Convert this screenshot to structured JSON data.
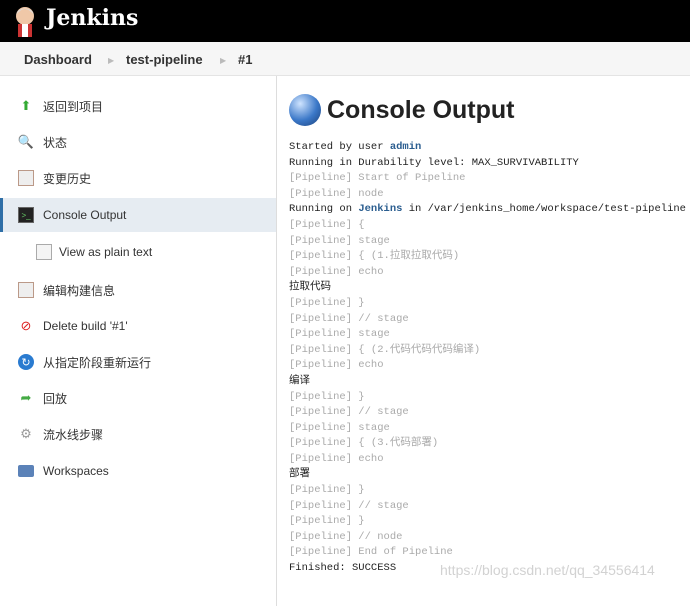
{
  "header": {
    "brand": "Jenkins"
  },
  "breadcrumb": [
    "Dashboard",
    "test-pipeline",
    "#1"
  ],
  "sidebar": {
    "items": [
      {
        "label": "返回到项目",
        "icon": "up-arrow-icon"
      },
      {
        "label": "状态",
        "icon": "search-icon"
      },
      {
        "label": "变更历史",
        "icon": "notepad-icon"
      },
      {
        "label": "Console Output",
        "icon": "terminal-icon"
      },
      {
        "label": "View as plain text",
        "icon": "document-icon"
      },
      {
        "label": "编辑构建信息",
        "icon": "notepad-icon"
      },
      {
        "label": "Delete build '#1'",
        "icon": "no-entry-icon"
      },
      {
        "label": "从指定阶段重新运行",
        "icon": "refresh-icon"
      },
      {
        "label": "回放",
        "icon": "replay-arrow-icon"
      },
      {
        "label": "流水线步骤",
        "icon": "gear-icon"
      },
      {
        "label": "Workspaces",
        "icon": "folder-icon"
      }
    ]
  },
  "main": {
    "title": "Console Output"
  },
  "console": [
    {
      "pre": "Started by user ",
      "link": "admin",
      "post": "",
      "gray": false
    },
    {
      "pre": "Running in Durability level: MAX_SURVIVABILITY",
      "gray": false
    },
    {
      "pre": "[Pipeline] Start of Pipeline",
      "gray": true
    },
    {
      "pre": "[Pipeline] node",
      "gray": true
    },
    {
      "pre": "Running on ",
      "link": "Jenkins",
      "post": " in /var/jenkins_home/workspace/test-pipeline",
      "gray": false
    },
    {
      "pre": "[Pipeline] {",
      "gray": true
    },
    {
      "pre": "[Pipeline] stage",
      "gray": true
    },
    {
      "pre": "[Pipeline] { (1.拉取拉取代码)",
      "gray": true
    },
    {
      "pre": "[Pipeline] echo",
      "gray": true
    },
    {
      "pre": "拉取代码",
      "gray": false
    },
    {
      "pre": "[Pipeline] }",
      "gray": true
    },
    {
      "pre": "[Pipeline] // stage",
      "gray": true
    },
    {
      "pre": "[Pipeline] stage",
      "gray": true
    },
    {
      "pre": "[Pipeline] { (2.代码代码代码编译)",
      "gray": true
    },
    {
      "pre": "[Pipeline] echo",
      "gray": true
    },
    {
      "pre": "编译",
      "gray": false
    },
    {
      "pre": "[Pipeline] }",
      "gray": true
    },
    {
      "pre": "[Pipeline] // stage",
      "gray": true
    },
    {
      "pre": "[Pipeline] stage",
      "gray": true
    },
    {
      "pre": "[Pipeline] { (3.代码部署)",
      "gray": true
    },
    {
      "pre": "[Pipeline] echo",
      "gray": true
    },
    {
      "pre": "部署",
      "gray": false
    },
    {
      "pre": "[Pipeline] }",
      "gray": true
    },
    {
      "pre": "[Pipeline] // stage",
      "gray": true
    },
    {
      "pre": "[Pipeline] }",
      "gray": true
    },
    {
      "pre": "[Pipeline] // node",
      "gray": true
    },
    {
      "pre": "[Pipeline] End of Pipeline",
      "gray": true
    },
    {
      "pre": "Finished: SUCCESS",
      "gray": false
    }
  ],
  "watermark": "https://blog.csdn.net/qq_34556414"
}
